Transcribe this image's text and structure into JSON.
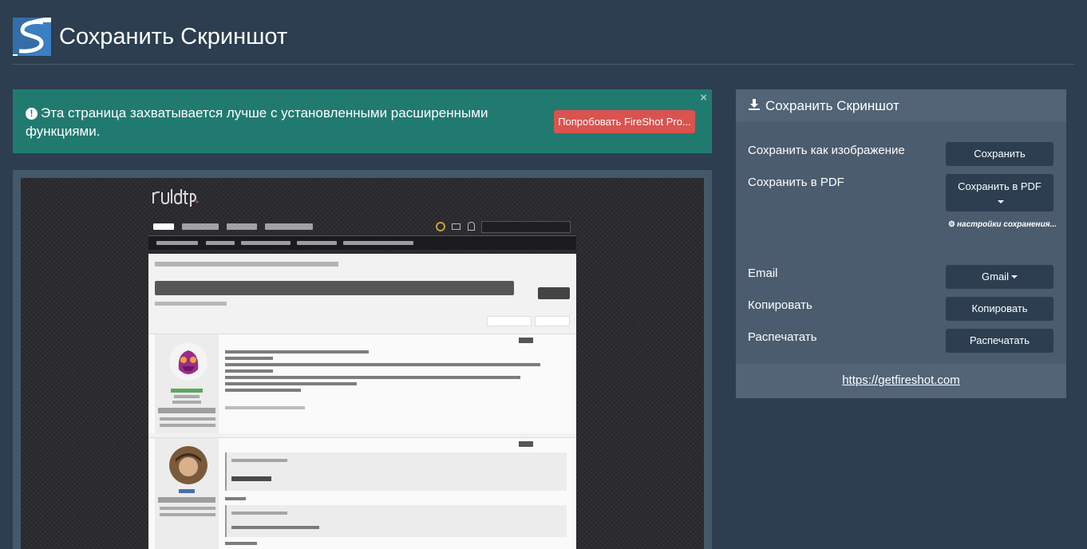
{
  "header": {
    "title": "Сохранить Скриншот"
  },
  "alert": {
    "message": "Эта страница захватывается лучше с установленными расширенными функциями.",
    "close_symbol": "×",
    "pro_button_label": "Попробовать FireShot Pro..."
  },
  "panel": {
    "title": "Сохранить Скриншот",
    "rows": [
      {
        "label": "Сохранить как изображение",
        "button": "Сохранить"
      },
      {
        "label": "Сохранить в PDF",
        "button": "Сохранить в PDF"
      },
      {
        "label": "Email",
        "button": "Gmail"
      },
      {
        "label": "Копировать",
        "button": "Копировать"
      },
      {
        "label": "Распечатать",
        "button": "Распечатать"
      }
    ],
    "settings_link": "настройки сохранения...",
    "footer_link": "https://getfireshot.com"
  },
  "colors": {
    "background": "#2c3e50",
    "alert_bg": "#217a70",
    "pro_button": "#d9534f",
    "panel_bg": "#4b5c6e",
    "button_bg": "#2c3e50"
  },
  "icons": {
    "logo": "fireshot-logo",
    "alert": "exclamation-circle-icon",
    "download": "download-icon",
    "settings": "gear-icon",
    "dropdown": "caret-down-icon"
  }
}
